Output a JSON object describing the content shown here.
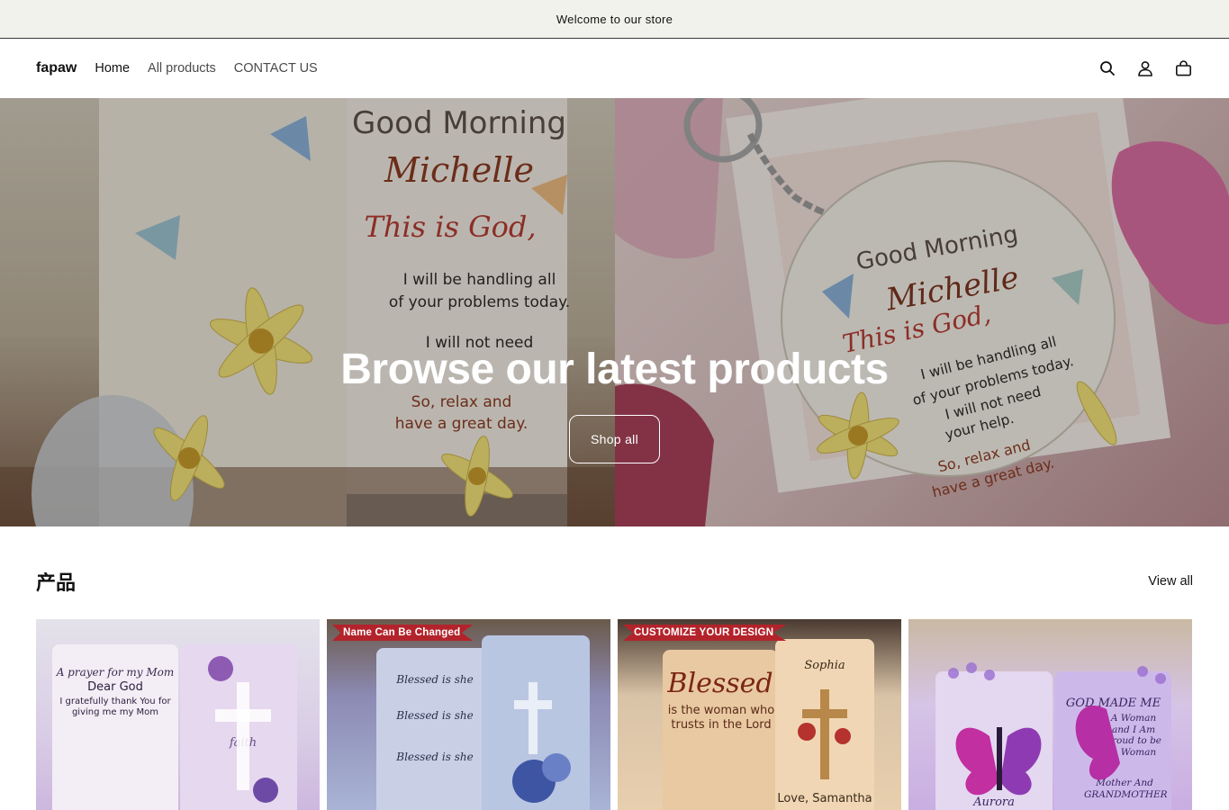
{
  "announcement": {
    "text": "Welcome to our store"
  },
  "header": {
    "logo": "fapaw",
    "nav": [
      {
        "label": "Home"
      },
      {
        "label": "All products"
      },
      {
        "label": "CONTACT US"
      }
    ],
    "icons": [
      "search-icon",
      "account-icon",
      "cart-icon"
    ]
  },
  "hero": {
    "title": "Browse our latest products",
    "button_label": "Shop all",
    "left_image": {
      "line1": "Good Morning",
      "line2": "Michelle",
      "line3": "This is God,",
      "line4": "I will be handling all",
      "line5": "of your problems today.",
      "line6": "I will not need",
      "line7": "So, relax and",
      "line8": "have a great day."
    },
    "right_image": {
      "line1": "Good Morning",
      "line2": "Michelle",
      "line3": "This is God,",
      "line4": "I will be handling all",
      "line5": "of your problems today.",
      "line6": "I will not need",
      "line7": "your help.",
      "line8": "So, relax and",
      "line9": "have a great day."
    }
  },
  "products_section": {
    "title": "产品",
    "view_all": "View all",
    "cards": [
      {
        "badge": "",
        "text_a": "A prayer for my Mom",
        "text_b": "Dear God",
        "text_c": "I gratefully thank You for giving me my Mom",
        "text_d": "faith"
      },
      {
        "badge": "Name Can Be Changed",
        "text_a": "Blessed is she",
        "text_b": "Blessed is she",
        "text_c": "Blessed is she",
        "text_d": ""
      },
      {
        "badge": "CUSTOMIZE YOUR DESIGN",
        "text_a": "Blessed",
        "text_b": "is the woman who trusts in the Lord",
        "text_c": "Sophia",
        "text_d": "Love, Samantha"
      },
      {
        "badge": "",
        "text_a": "GOD MADE ME",
        "text_b": "A Woman and I Am Proud to be A Woman",
        "text_c": "Mother And GRANDMOTHER",
        "text_d": "Aurora"
      }
    ]
  }
}
